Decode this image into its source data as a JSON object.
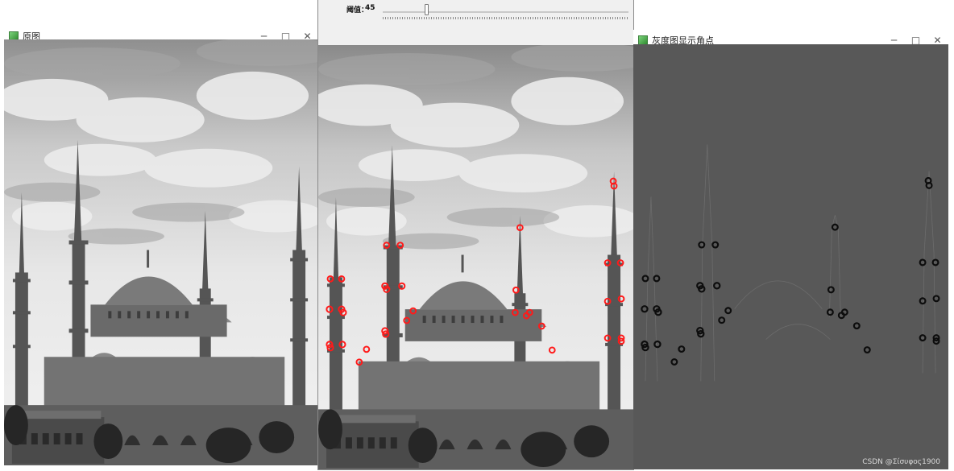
{
  "windows": {
    "original": {
      "title": "原图"
    },
    "threshold": {
      "title": "",
      "trackbar_label": "阈值：",
      "trackbar_value": "45",
      "trackbar_max": 255
    },
    "gray": {
      "title": "灰度图显示角点"
    }
  },
  "controls": {
    "minimize": "─",
    "maximize": "□",
    "close": "✕"
  },
  "watermark": "CSDN @Σίσυφος1900",
  "colors": {
    "marker_color": "#ff1a1a",
    "gray_canvas_color": "#585858",
    "gray_marker_color": "#0d0d0d"
  }
}
